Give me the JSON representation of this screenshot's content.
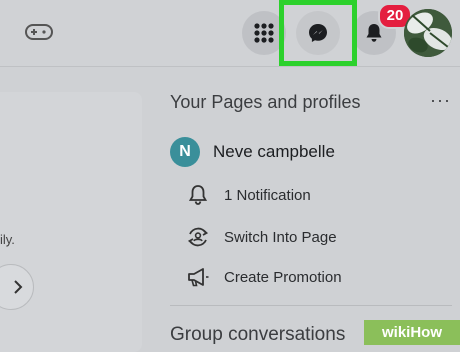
{
  "header": {
    "notification_badge": "20",
    "highlight_color": "#2cd12c",
    "badge_color": "#e41e3f"
  },
  "left_panel": {
    "fragment_text": "ily."
  },
  "pages_section": {
    "title": "Your Pages and profiles",
    "more": "···",
    "page": {
      "initial": "N",
      "name": "Neve campbelle"
    },
    "actions": [
      {
        "label": "1 Notification",
        "icon": "bell-icon"
      },
      {
        "label": "Switch Into Page",
        "icon": "switch-profile-icon"
      },
      {
        "label": "Create Promotion",
        "icon": "megaphone-icon"
      }
    ]
  },
  "group_section": {
    "title": "Group conversations"
  },
  "watermark": {
    "text": "wikiHow"
  }
}
